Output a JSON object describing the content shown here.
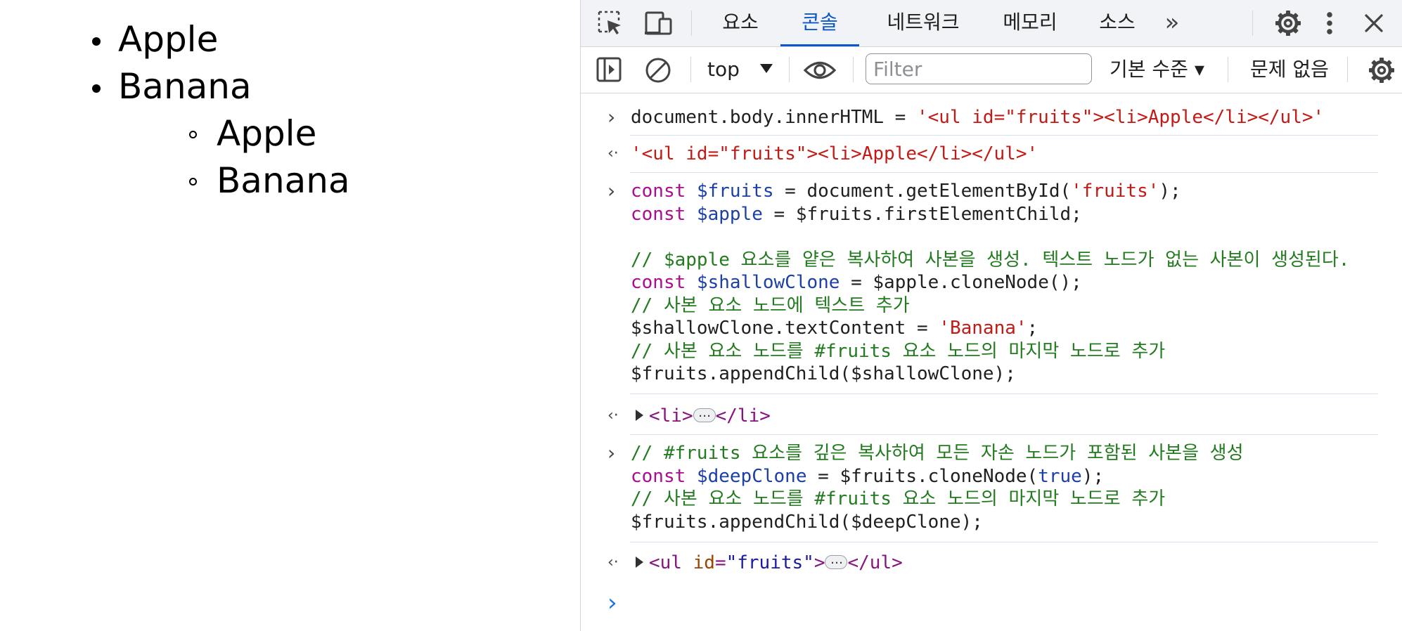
{
  "page": {
    "list": [
      "Apple",
      "Banana"
    ],
    "nested_list": [
      "Apple",
      "Banana"
    ]
  },
  "devtools": {
    "tabs": [
      "요소",
      "콘솔",
      "네트워크",
      "메모리",
      "소스"
    ],
    "active_tab": "콘솔",
    "more_tabs": "»",
    "toolbar": {
      "context": "top",
      "filter_placeholder": "Filter",
      "log_level": "기본 수준 ▾",
      "issues": "문제 없음"
    }
  },
  "console": {
    "cmd1": "document.body.innerHTML = ",
    "cmd1_str": "'<ul id=\"fruits\"><li>Apple</li></ul>'",
    "res1": "'<ul id=\"fruits\"><li>Apple</li></ul>'",
    "c2": {
      "const": "const",
      "fruits_var": "$fruits",
      "fruits_mid": " = document.getElementById(",
      "fruits_arg": "'fruits'",
      "fruits_end": ");",
      "apple_var": "$apple",
      "apple_rest": " = $fruits.firstElementChild;",
      "comment1": "// $apple 요소를 얕은 복사하여 사본을 생성. 텍스트 노드가 없는 사본이 생성된다.",
      "shallow_var": "$shallowClone",
      "shallow_rest": " = $apple.cloneNode();",
      "comment2": "// 사본 요소 노드에 텍스트 추가",
      "text_pre": "$shallowClone.textContent = ",
      "text_str": "'Banana'",
      "text_end": ";",
      "comment3": "// 사본 요소 노드를 #fruits 요소 노드의 마지막 노드로 추가",
      "append1": "$fruits.appendChild($shallowClone);"
    },
    "res2": {
      "open": "<li>",
      "close": "</li>"
    },
    "c3": {
      "comment1": "// #fruits 요소를 깊은 복사하여 모든 자손 노드가 포함된 사본을 생성",
      "const": "const",
      "deep_var": "$deepClone",
      "deep_mid": " = $fruits.cloneNode(",
      "deep_arg": "true",
      "deep_end": ");",
      "comment2": "// 사본 요소 노드를 #fruits 요소 노드의 마지막 노드로 추가",
      "append2": "$fruits.appendChild($deepClone);"
    },
    "res3": {
      "open": "<ul",
      "attr": "id",
      "eq": "=",
      "val": "\"fruits\"",
      "gt": ">",
      "close": "</ul>"
    },
    "ellipsis": "…",
    "input_prompt": "›",
    "in_prompt": "›",
    "out_prompt": "‹·"
  }
}
